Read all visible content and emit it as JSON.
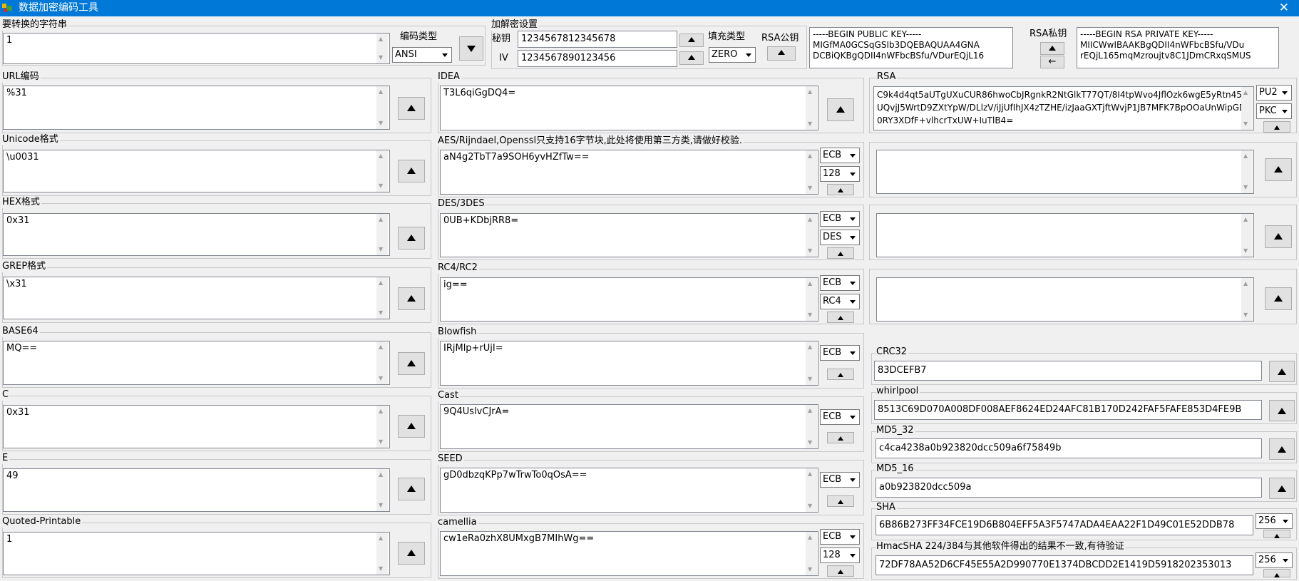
{
  "window": {
    "title": "数据加密编码工具",
    "close": "✕"
  },
  "input": {
    "caption": "要转换的字符串",
    "value": "1"
  },
  "encoding": {
    "caption": "编码类型",
    "value": "ANSI"
  },
  "crypto": {
    "caption": "加解密设置",
    "key_label": "秘钥",
    "key_value": "1234567812345678",
    "iv_label": "IV",
    "iv_value": "1234567890123456",
    "padding_label": "填充类型",
    "padding_value": "ZERO"
  },
  "rsa_pub": {
    "label": "RSA公钥",
    "value": "-----BEGIN PUBLIC KEY-----\nMIGfMA0GCSqGSIb3DQEBAQUAA4GNA\nDCBiQKBgQDII4nWFbcBSfu/VDurEQjL16"
  },
  "rsa_priv": {
    "label": "RSA私钥",
    "arrow": "←",
    "value": "-----BEGIN RSA PRIVATE KEY-----\nMIICWwIBAAKBgQDII4nWFbcBSfu/VDu\nrEQjL165mqMzroujtv8C1JDmCRxqSMUS"
  },
  "left": [
    {
      "caption": "URL编码",
      "value": "%31"
    },
    {
      "caption": "Unicode格式",
      "value": "\\u0031"
    },
    {
      "caption": "HEX格式",
      "value": "0x31"
    },
    {
      "caption": "GREP格式",
      "value": "\\x31"
    },
    {
      "caption": "BASE64",
      "value": "MQ=="
    },
    {
      "caption": "C",
      "value": "0x31"
    },
    {
      "caption": "E",
      "value": "49"
    },
    {
      "caption": "Quoted-Printable",
      "value": "1"
    }
  ],
  "middle": [
    {
      "caption": "IDEA",
      "value": "T3L6qiGgDQ4="
    },
    {
      "caption": "AES/Rijndael,Openssl只支持16字节块,此处将使用第三方类,请做好校验.",
      "value": "aN4g2TbT7a9SOH6yvHZfTw==",
      "mode": "ECB",
      "opt": "128"
    },
    {
      "caption": "DES/3DES",
      "value": "0UB+KDbjRR8=",
      "mode": "ECB",
      "opt": "DES"
    },
    {
      "caption": "RC4/RC2",
      "value": "ig==",
      "mode": "ECB",
      "opt": "RC4"
    },
    {
      "caption": "Blowfish",
      "value": "IRjMlp+rUjI=",
      "mode": "ECB"
    },
    {
      "caption": "Cast",
      "value": "9Q4UslvCJrA=",
      "mode": "ECB"
    },
    {
      "caption": "SEED",
      "value": "gD0dbzqKPp7wTrwTo0qOsA==",
      "mode": "ECB"
    },
    {
      "caption": "camellia",
      "value": "cw1eRa0zhX8UMxgB7MIhWg==",
      "mode": "ECB",
      "opt": "128"
    }
  ],
  "rsa": {
    "caption": "RSA",
    "value": "C9k4d4qt5aUTgUXuCUR86hwoCbJRgnkR2NtGlkT77QT/8I4tpWvo4JflOzk6wgE5yRtn45oUQvjJ5WrtD9ZXtYpW/DLlzV/iJjUfIhJX4zTZHE/izJaaGXTjftWvjP1JB7MFK7BpOOaUnWipGD0RY3XDfF+vlhcrTxUW+IuTlB4=",
    "opt1": "PU2",
    "opt2": "PKC"
  },
  "right": [
    {
      "caption": "CRC32",
      "value": "83DCEFB7"
    },
    {
      "caption": "whirlpool",
      "value": "8513C69D070A008DF008AEF8624ED24AFC81B170D242FAF5FAFE853D4FE9B"
    },
    {
      "caption": "MD5_32",
      "value": "c4ca4238a0b923820dcc509a6f75849b"
    },
    {
      "caption": "MD5_16",
      "value": "a0b923820dcc509a"
    },
    {
      "caption": "SHA",
      "value": "6B86B273FF34FCE19D6B804EFF5A3F5747ADA4EAA22F1D49C01E52DDB78",
      "opt": "256"
    },
    {
      "caption": "HmacSHA 224/384与其他软件得出的结果不一致,有待验证",
      "value": "72DF78AA52D6CF45E55A2D990770E1374DBCDD2E1419D5918202353013",
      "opt": "256"
    }
  ]
}
